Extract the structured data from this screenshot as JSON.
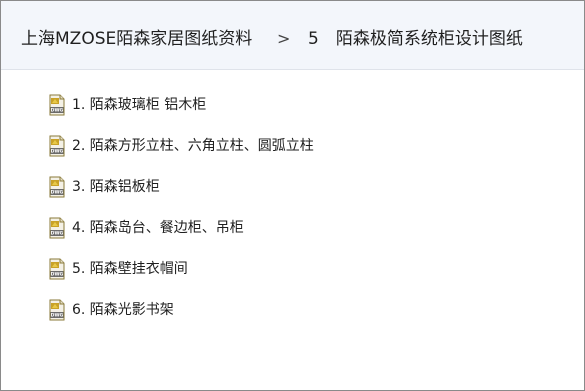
{
  "breadcrumb": {
    "root": "上海MZOSE陌森家居图纸资料",
    "separator": ">",
    "current": "5　陌森极简系统柜设计图纸"
  },
  "files": [
    {
      "label": "1. 陌森玻璃柜 铝木柜",
      "icon": "dwg-file-icon"
    },
    {
      "label": "2. 陌森方形立柱、六角立柱、圆弧立柱",
      "icon": "dwg-file-icon"
    },
    {
      "label": "3. 陌森铝板柜",
      "icon": "dwg-file-icon"
    },
    {
      "label": "4. 陌森岛台、餐边柜、吊柜",
      "icon": "dwg-file-icon"
    },
    {
      "label": "5. 陌森壁挂衣帽间",
      "icon": "dwg-file-icon"
    },
    {
      "label": "6. 陌森光影书架",
      "icon": "dwg-file-icon"
    }
  ],
  "icon_text": "DWG",
  "colors": {
    "header_bg": "#f3f6fb",
    "icon_body": "#c9a227",
    "icon_band": "#6b6b6b",
    "text": "#1f1f1f"
  }
}
